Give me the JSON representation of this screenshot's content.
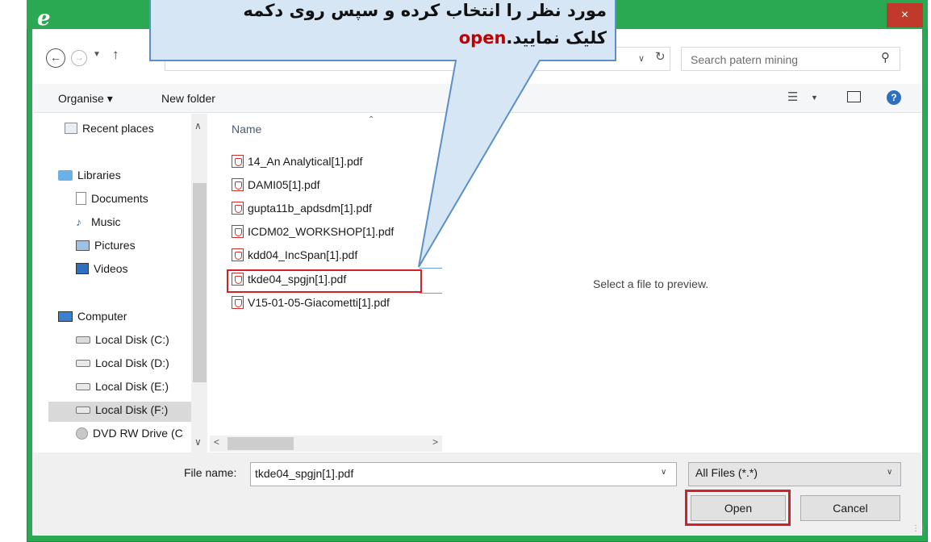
{
  "window": {
    "close_label": "×"
  },
  "address": {
    "search_placeholder": "Search patern mining"
  },
  "toolbar": {
    "organise_label": "Organise ▾",
    "new_folder_label": "New folder"
  },
  "nav_pane": {
    "items": [
      {
        "label": "Recent places",
        "icon": "recent-places-icon"
      },
      {
        "label": "Libraries",
        "icon": "libraries-icon"
      },
      {
        "label": "Documents",
        "icon": "documents-icon"
      },
      {
        "label": "Music",
        "icon": "music-icon"
      },
      {
        "label": "Pictures",
        "icon": "pictures-icon"
      },
      {
        "label": "Videos",
        "icon": "videos-icon"
      },
      {
        "label": "Computer",
        "icon": "computer-icon"
      },
      {
        "label": "Local Disk (C:)",
        "icon": "drive-icon"
      },
      {
        "label": "Local Disk (D:)",
        "icon": "drive-icon"
      },
      {
        "label": "Local Disk (E:)",
        "icon": "drive-icon"
      },
      {
        "label": "Local Disk (F:)",
        "icon": "drive-icon"
      },
      {
        "label": "DVD RW Drive (C",
        "icon": "dvd-icon"
      }
    ],
    "selected": "Local Disk (F:)"
  },
  "file_list": {
    "column_name": "Name",
    "files": [
      "14_An Analytical[1].pdf",
      "DAMI05[1].pdf",
      "gupta11b_apdsdm[1].pdf",
      "ICDM02_WORKSHOP[1].pdf",
      "kdd04_IncSpan[1].pdf",
      "tkde04_spgjn[1].pdf",
      "V15-01-05-Giacometti[1].pdf"
    ],
    "highlighted": "tkde04_spgjn[1].pdf"
  },
  "preview": {
    "message": "Select a file to preview."
  },
  "footer": {
    "file_name_label": "File name:",
    "file_name_value": "tkde04_spgjn[1].pdf",
    "filter_value": "All Files (*.*)",
    "open_label": "Open",
    "cancel_label": "Cancel"
  },
  "callout": {
    "line1": "مورد نظر را انتخاب کرده و سپس روی دکمه",
    "keyword": "open",
    "line2_rest": "کلیک نمایید."
  },
  "colors": {
    "frame": "#2aa952",
    "highlight": "#d32029",
    "callout_fill": "#d6e6f5"
  }
}
